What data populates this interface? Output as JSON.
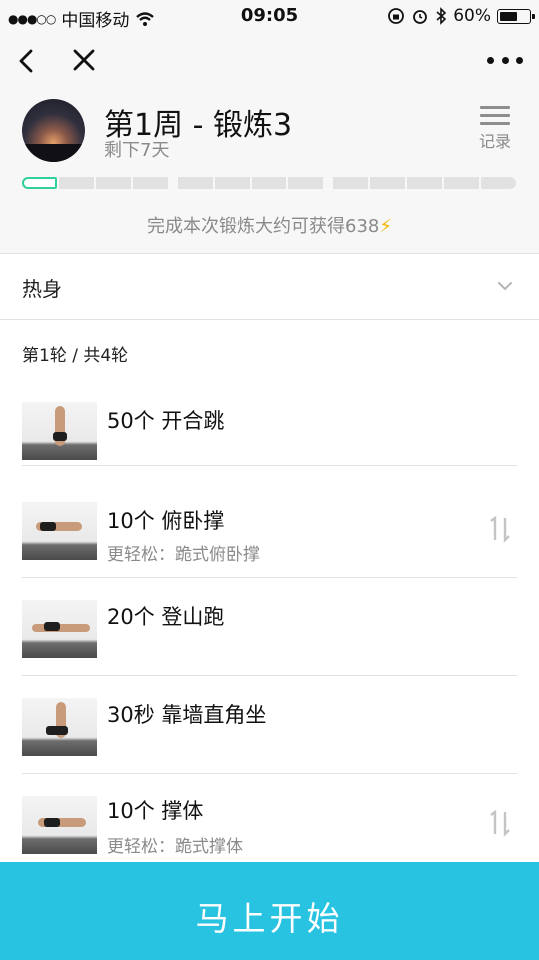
{
  "status_bar": {
    "carrier": "中国移动",
    "time": "09:05",
    "battery": "60%",
    "battery_level": 0.6
  },
  "nav": {
    "back_icon": "chevron-left-icon",
    "close_icon": "close-icon",
    "more_icon": "more-dots-icon"
  },
  "workout": {
    "title": "第1周 - 锻炼3",
    "remaining": "剩下7天",
    "record_label": "记录",
    "progress_segments": 13,
    "progress_active_index": 0,
    "reward_text": "完成本次锻炼大约可获得638",
    "reward_icon": "⚡"
  },
  "warmup": {
    "label": "热身"
  },
  "round": {
    "label": "第1轮 / 共4轮"
  },
  "exercises": [
    {
      "name": "50个 开合跳",
      "easier": ""
    },
    {
      "name": "10个 俯卧撑",
      "easier": "更轻松：跪式俯卧撑",
      "swap": "1↓"
    },
    {
      "name": "20个 登山跑",
      "easier": ""
    },
    {
      "name": "30秒 靠墙直角坐",
      "easier": ""
    },
    {
      "name": "10个 撑体",
      "easier": "更轻松：跪式撑体",
      "swap": "1↓"
    }
  ],
  "start_button": {
    "label": "马上开始"
  },
  "colors": {
    "accent_green": "#31cf9b",
    "start_bar": "#28c3e0",
    "bolt": "#f2b400"
  }
}
